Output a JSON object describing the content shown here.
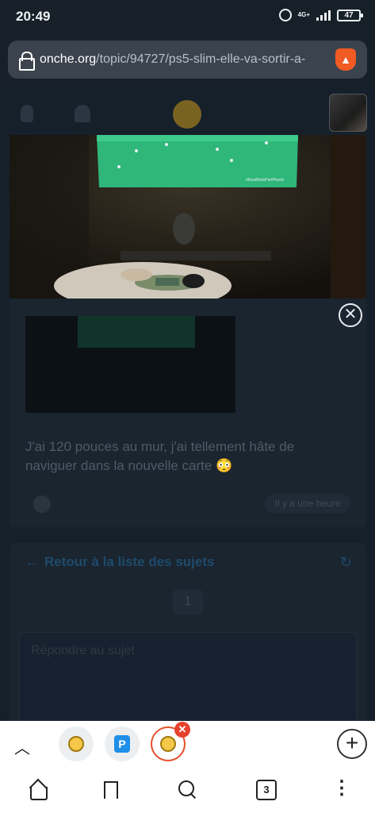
{
  "status": {
    "time": "20:49",
    "network": "4G+",
    "battery": "47"
  },
  "browser": {
    "url_domain": "onche.org",
    "url_path": "/topic/94727/ps5-slim-elle-va-sortir-a-"
  },
  "post": {
    "text": "J'ai 120 pouces au mur, j'ai tellement hâte de naviguer dans la nouvelle carte 😳",
    "time_ago": "Il y a une heure"
  },
  "nav": {
    "back_label": "Retour à la liste des sujets",
    "page_number": "1",
    "reply_placeholder": "Répondre au sujet"
  },
  "lightbox": {
    "close_glyph": "✕",
    "video_caption": "#RealBetisPartPhorid"
  },
  "tabs": {
    "count": "3",
    "new_tab_glyph": "+",
    "close_glyph": "✕",
    "p_favicon": "P"
  },
  "colors": {
    "brave": "#f05a23",
    "active_tab_border": "#e4502a",
    "projection_green": "#2fb77a"
  }
}
